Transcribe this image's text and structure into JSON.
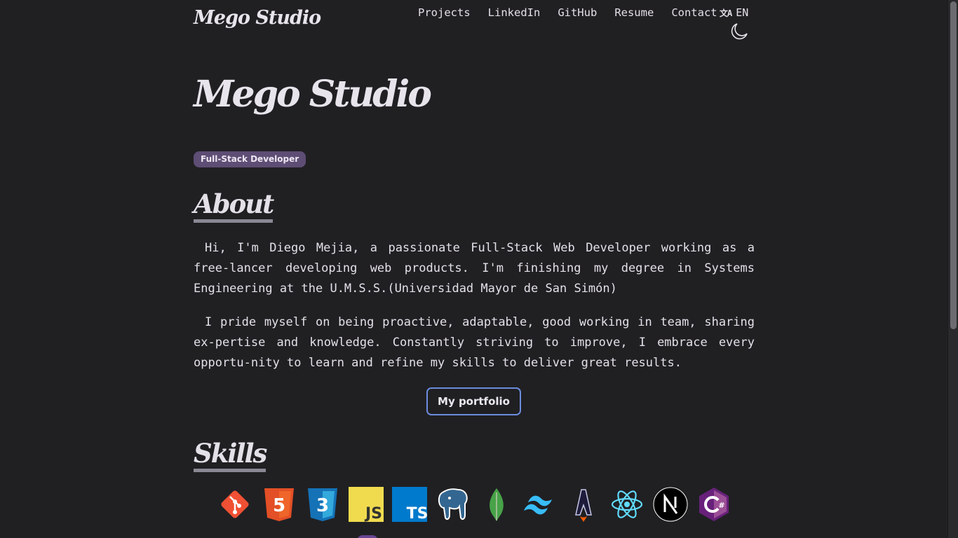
{
  "header": {
    "brand": "Mego Studio",
    "nav": [
      "Projects",
      "LinkedIn",
      "GitHub",
      "Resume",
      "Contact"
    ],
    "language": "EN",
    "language_icon": "translate-icon",
    "theme_icon": "moon-icon"
  },
  "hero": {
    "title": "Mego Studio",
    "role_badge": "Full-Stack Developer"
  },
  "about": {
    "heading": "About",
    "paragraph1": "Hi, I'm Diego Mejia, a passionate Full-Stack Web Developer working as a free-lancer developing web products. I'm finishing my degree in Systems Engineering at the U.M.S.S.(Universidad Mayor de San Simón)",
    "paragraph2": "I pride myself on being proactive, adaptable, good working in team, sharing ex-pertise and knowledge. Constantly striving to improve, I embrace every opportu-nity to learn and refine my skills to deliver great results.",
    "portfolio_button": "My portfolio"
  },
  "skills": {
    "heading": "Skills",
    "items": [
      "git-icon",
      "html5-icon",
      "css3-icon",
      "javascript-icon",
      "typescript-icon",
      "postgresql-icon",
      "mongodb-icon",
      "tailwindcss-icon",
      "astro-icon",
      "react-icon",
      "nextjs-icon",
      "csharp-icon"
    ]
  },
  "colors": {
    "background": "#202023",
    "badge": "#5e4d74",
    "button_border": "#6b8cdd",
    "heading_underline": "#8a8893"
  }
}
